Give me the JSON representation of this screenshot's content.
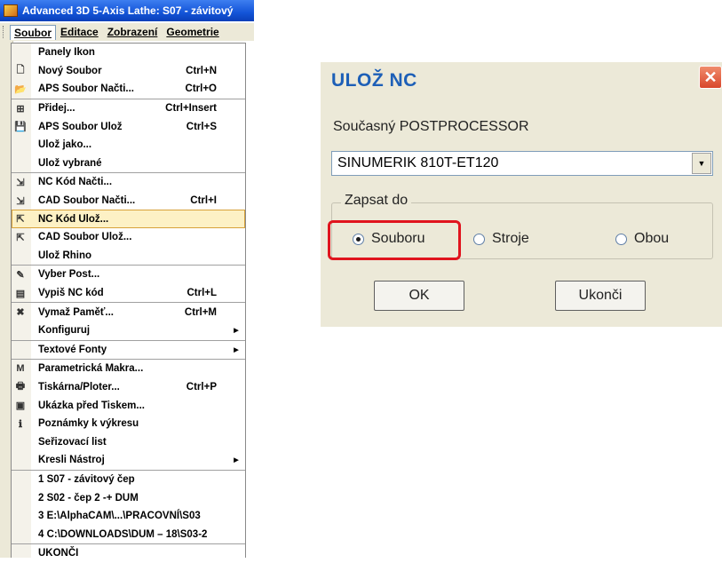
{
  "app": {
    "title": "Advanced 3D 5-Axis Lathe: S07 - závitový",
    "menubar": [
      "Soubor",
      "Editace",
      "Zobrazení",
      "Geometrie"
    ]
  },
  "menu": {
    "items": [
      {
        "label": "Panely Ikon",
        "shortcut": "",
        "icon": "",
        "sep": false,
        "submenu": false
      },
      {
        "label": "Nový Soubor",
        "shortcut": "Ctrl+N",
        "icon": "new-file-icon",
        "glyph": "🗋",
        "sep": false,
        "submenu": false
      },
      {
        "label": "APS Soubor Načti...",
        "shortcut": "Ctrl+O",
        "icon": "open-folder-icon",
        "glyph": "📂",
        "sep": false,
        "submenu": false
      },
      {
        "label": "Přidej...",
        "shortcut": "Ctrl+Insert",
        "icon": "insert-icon",
        "glyph": "⊞",
        "sep": true,
        "submenu": false
      },
      {
        "label": "APS Soubor Ulož",
        "shortcut": "Ctrl+S",
        "icon": "save-disk-icon",
        "glyph": "💾",
        "sep": false,
        "submenu": false
      },
      {
        "label": "Ulož jako...",
        "shortcut": "",
        "icon": "",
        "sep": false,
        "submenu": false
      },
      {
        "label": "Ulož vybrané",
        "shortcut": "",
        "icon": "",
        "sep": false,
        "submenu": false
      },
      {
        "label": "NC Kód Načti...",
        "shortcut": "",
        "icon": "nc-load-icon",
        "glyph": "⇲",
        "sep": true,
        "submenu": false
      },
      {
        "label": "CAD Soubor Načti...",
        "shortcut": "Ctrl+I",
        "icon": "cad-load-icon",
        "glyph": "⇲",
        "sep": false,
        "submenu": false
      },
      {
        "label": "NC Kód Ulož...",
        "shortcut": "",
        "icon": "nc-save-icon",
        "glyph": "⇱",
        "sep": false,
        "submenu": false,
        "highlight": true
      },
      {
        "label": "CAD Soubor Ulož...",
        "shortcut": "",
        "icon": "cad-save-icon",
        "glyph": "⇱",
        "sep": false,
        "submenu": false
      },
      {
        "label": "Ulož Rhino",
        "shortcut": "",
        "icon": "",
        "sep": false,
        "submenu": false
      },
      {
        "label": "Vyber Post...",
        "shortcut": "",
        "icon": "post-select-icon",
        "glyph": "✎",
        "sep": true,
        "submenu": false
      },
      {
        "label": "Vypiš NC kód",
        "shortcut": "Ctrl+L",
        "icon": "nc-list-icon",
        "glyph": "▤",
        "sep": false,
        "submenu": false
      },
      {
        "label": "Vymaž Paměť...",
        "shortcut": "Ctrl+M",
        "icon": "erase-memory-icon",
        "glyph": "✖",
        "sep": true,
        "submenu": false
      },
      {
        "label": "Konfiguruj",
        "shortcut": "",
        "icon": "",
        "sep": false,
        "submenu": true
      },
      {
        "label": "Textové Fonty",
        "shortcut": "",
        "icon": "",
        "sep": true,
        "submenu": true
      },
      {
        "label": "Parametrická Makra...",
        "shortcut": "",
        "icon": "macro-icon",
        "glyph": "M",
        "sep": true,
        "submenu": false
      },
      {
        "label": "Tiskárna/Ploter...",
        "shortcut": "Ctrl+P",
        "icon": "printer-icon",
        "glyph": "🖶",
        "sep": false,
        "submenu": false
      },
      {
        "label": "Ukázka před Tiskem...",
        "shortcut": "",
        "icon": "print-preview-icon",
        "glyph": "▣",
        "sep": false,
        "submenu": false
      },
      {
        "label": "Poznámky k výkresu",
        "shortcut": "",
        "icon": "info-icon",
        "glyph": "ℹ",
        "sep": false,
        "submenu": false
      },
      {
        "label": "Seřizovací list",
        "shortcut": "",
        "icon": "",
        "sep": false,
        "submenu": false
      },
      {
        "label": "Kresli Nástroj",
        "shortcut": "",
        "icon": "",
        "sep": false,
        "submenu": true
      },
      {
        "label": "1 S07 - závitový čep",
        "shortcut": "",
        "icon": "",
        "sep": true,
        "submenu": false
      },
      {
        "label": "2 S02 - čep 2 -+ DUM",
        "shortcut": "",
        "icon": "",
        "sep": false,
        "submenu": false
      },
      {
        "label": "3 E:\\AlphaCAM\\...\\PRACOVNÍ\\S03",
        "shortcut": "",
        "icon": "",
        "sep": false,
        "submenu": false
      },
      {
        "label": "4 C:\\DOWNLOADS\\DUM – 18\\S03-2",
        "shortcut": "",
        "icon": "",
        "sep": false,
        "submenu": false
      },
      {
        "label": "UKONČI",
        "shortcut": "",
        "icon": "",
        "sep": true,
        "submenu": false
      }
    ]
  },
  "dialog": {
    "title": "ULOŽ NC",
    "close_glyph": "✕",
    "postprocessor_label": "Současný POSTPROCESSOR",
    "postprocessor_value": "SINUMERIK 810T-ET120",
    "dropdown_glyph": "▼",
    "group_label": "Zapsat do",
    "radios": [
      {
        "label": "Souboru",
        "selected": true
      },
      {
        "label": "Stroje",
        "selected": false
      },
      {
        "label": "Obou",
        "selected": false
      }
    ],
    "ok_label": "OK",
    "cancel_label": "Ukonči"
  },
  "colors": {
    "title_bar": "#1354d8",
    "dialog_title_text": "#1d5fb7",
    "highlight_box": "#e0141e",
    "menu_highlight": "#fdf1c5"
  }
}
